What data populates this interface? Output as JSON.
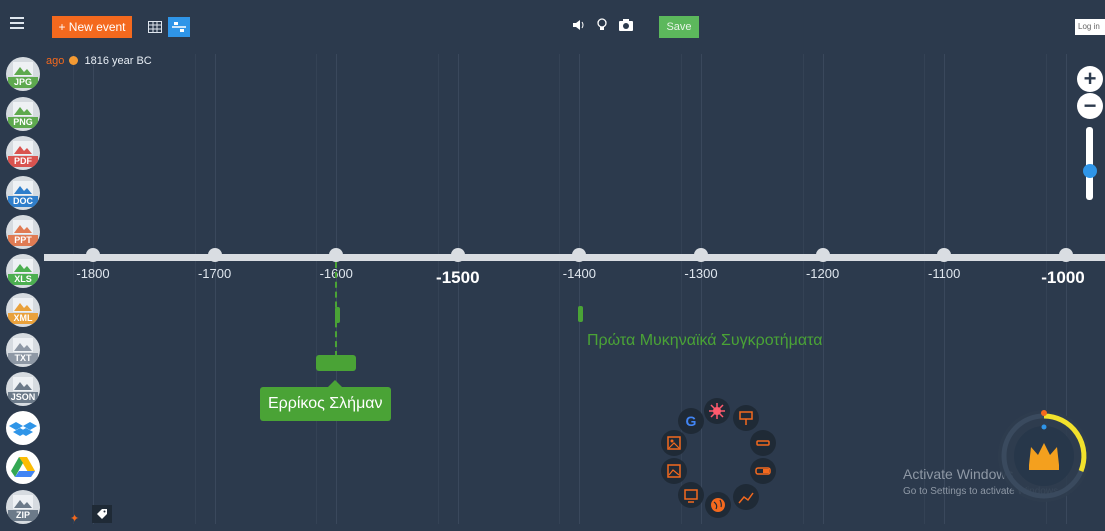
{
  "toolbar": {
    "new_event_label": "+ New event",
    "save_label": "Save",
    "login_label": "Log in"
  },
  "era_indicator": {
    "prefix": "ago",
    "value": "1816 year BC"
  },
  "sidebar": {
    "exports": [
      {
        "name": "jpg",
        "label": "JPG",
        "color": "#5ea94e"
      },
      {
        "name": "png",
        "label": "PNG",
        "color": "#5ea94e"
      },
      {
        "name": "pdf",
        "label": "PDF",
        "color": "#d9534f"
      },
      {
        "name": "doc",
        "label": "DOC",
        "color": "#2f7ecb"
      },
      {
        "name": "ppt",
        "label": "PPT",
        "color": "#e07b53"
      },
      {
        "name": "xls",
        "label": "XLS",
        "color": "#4caf50"
      },
      {
        "name": "xml",
        "label": "XML",
        "color": "#e9a13b"
      },
      {
        "name": "txt",
        "label": "TXT",
        "color": "#8e98a5"
      },
      {
        "name": "json",
        "label": "JSON",
        "color": "#6c7a89"
      },
      {
        "name": "dropbox",
        "label": "",
        "color": "#2f95e8"
      },
      {
        "name": "google-drive",
        "label": "",
        "color": "#fbbc05"
      },
      {
        "name": "zip",
        "label": "ZIP",
        "color": "#6c7a89"
      }
    ]
  },
  "timeline": {
    "ticks": [
      {
        "label": "-1800",
        "major": false
      },
      {
        "label": "-1700",
        "major": false
      },
      {
        "label": "-1600",
        "major": false
      },
      {
        "label": "-1500",
        "major": true
      },
      {
        "label": "-1400",
        "major": false
      },
      {
        "label": "-1300",
        "major": false
      },
      {
        "label": "-1200",
        "major": false
      },
      {
        "label": "-1100",
        "major": false
      },
      {
        "label": "-1000",
        "major": true
      }
    ],
    "events": [
      {
        "title": "Ερρίκος Σλήμαν",
        "year": -1600
      },
      {
        "title": "Πρώτα Μυκηναϊκά Συγκροτήματα",
        "year": -1400
      }
    ]
  },
  "zoom": {
    "plus": "+",
    "minus": "−",
    "level": 0.5
  },
  "watermark": {
    "title": "Activate Windows",
    "subtitle": "Go to Settings to activate Windows."
  },
  "colors": {
    "accent_orange": "#f4691e",
    "accent_blue": "#2f95e8",
    "event_green": "#4aa336",
    "background": "#2c3a4d"
  }
}
